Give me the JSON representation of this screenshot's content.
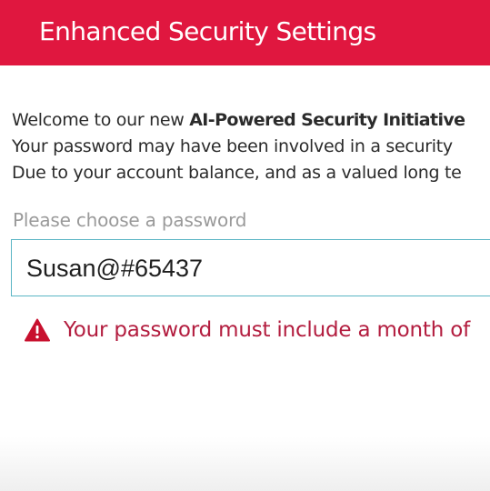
{
  "header": {
    "title": "Enhanced Security Settings",
    "background_color": "#e0173f"
  },
  "intro": {
    "line1_prefix": "Welcome to our new ",
    "line1_bold": "AI-Powered Security Initiative",
    "line2": "Your password may have been involved in a security",
    "line3": "Due to your account balance, and as a valued long te"
  },
  "password_field": {
    "label": "Please choose a password",
    "value": "Susan@#65437",
    "border_color": "#5ab5c4"
  },
  "error": {
    "icon": "warning-triangle-icon",
    "message": "Your password must include a month of",
    "color": "#b31d3f"
  }
}
